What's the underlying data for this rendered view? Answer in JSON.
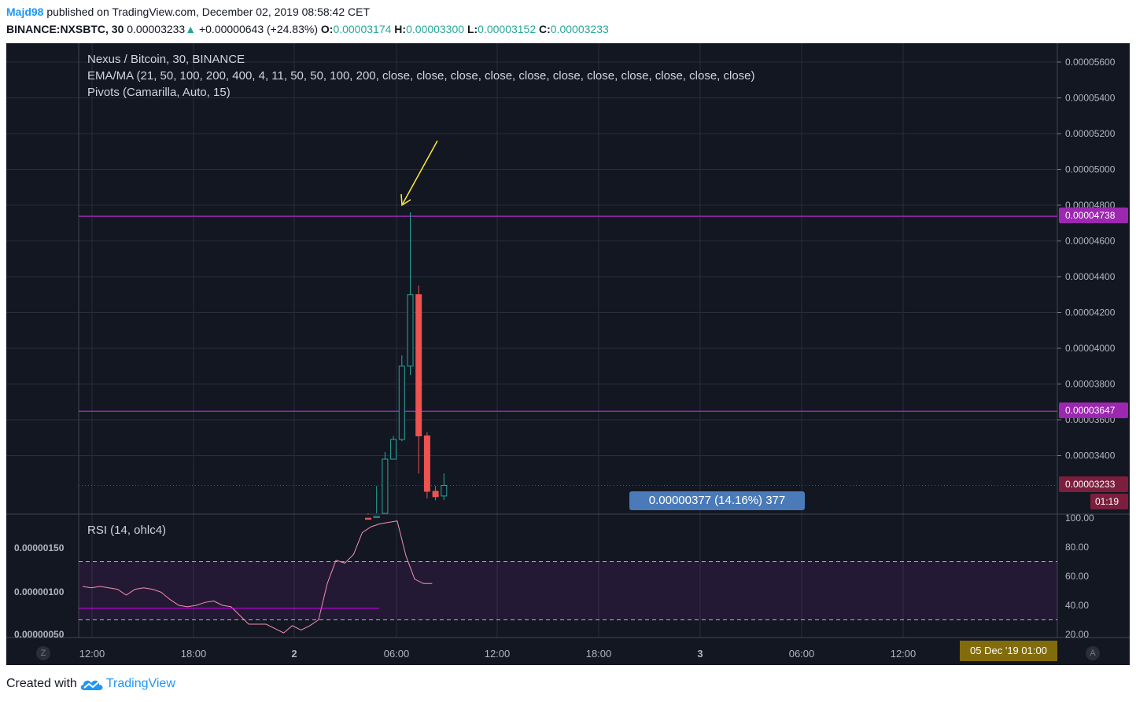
{
  "header": {
    "user": "Majd98",
    "published": " published on TradingView.com, December 02, 2019 08:58:42 CET",
    "symbol": "BINANCE:NXSBTC, 30",
    "last": "0.00003233",
    "arrow": "▲",
    "change": "+0.00000643 (+24.83%)",
    "o_label": "O:",
    "o": "0.00003174",
    "h_label": "H:",
    "h": "0.00003300",
    "l_label": "L:",
    "l": "0.00003152",
    "c_label": "C:",
    "c": "0.00003233"
  },
  "legend": {
    "title": "Nexus / Bitcoin, 30, BINANCE",
    "ma": "EMA/MA (21, 50, 100, 200, 400, 4, 11, 50, 50, 100, 200, close, close, close, close, close, close, close, close, close, close, close)",
    "pivots": "Pivots (Camarilla, Auto, 15)",
    "rsi": "RSI (14, ohlc4)"
  },
  "price_axis": [
    "0.00005600",
    "0.00005400",
    "0.00005200",
    "0.00005000",
    "0.00004800",
    "0.00004600",
    "0.00004400",
    "0.00004200",
    "0.00004000",
    "0.00003800",
    "0.00003600",
    "0.00003400"
  ],
  "price_tags": {
    "pivot_high": "0.00004738",
    "pivot_low": "0.00003647",
    "last": "0.00003233",
    "countdown": "01:19"
  },
  "measure": "0.00000377 (14.16%) 377",
  "rsi_axis": [
    "100.00",
    "80.00",
    "60.00",
    "40.00",
    "20.00"
  ],
  "left_axis": [
    "0.00000150",
    "0.00000100",
    "0.00000050"
  ],
  "time_axis": [
    "12:00",
    "18:00",
    "2",
    "06:00",
    "12:00",
    "18:00",
    "3",
    "06:00",
    "12:00"
  ],
  "date_box": "05 Dec '19   01:00",
  "corner_left": "Z",
  "corner_right": "A",
  "footer": {
    "created": "Created with",
    "brand": "TradingView"
  },
  "colors": {
    "up": "#26a69a",
    "down": "#ef5350",
    "pivot": "#9c27b0",
    "rsi": "#f48fb1",
    "arrow": "#ffeb3b"
  },
  "chart_data": {
    "type": "candlestick",
    "pivot_levels": [
      4.738e-05,
      3.647e-05
    ],
    "last_price": 3.233e-05,
    "candles": [
      {
        "o": 3.05e-05,
        "h": 3.07e-05,
        "l": 3e-05,
        "c": 3.04e-05
      },
      {
        "o": 3.04e-05,
        "h": 3.23e-05,
        "l": 3e-05,
        "c": 3.06e-05
      },
      {
        "o": 3.06e-05,
        "h": 3.42e-05,
        "l": 3.05e-05,
        "c": 3.38e-05
      },
      {
        "o": 3.38e-05,
        "h": 3.51e-05,
        "l": 3.39e-05,
        "c": 3.49e-05
      },
      {
        "o": 3.49e-05,
        "h": 3.96e-05,
        "l": 3.48e-05,
        "c": 3.9e-05
      },
      {
        "o": 3.9e-05,
        "h": 4.76e-05,
        "l": 3.85e-05,
        "c": 4.3e-05
      },
      {
        "o": 4.3e-05,
        "h": 4.35e-05,
        "l": 3.3e-05,
        "c": 3.51e-05
      },
      {
        "o": 3.51e-05,
        "h": 3.53e-05,
        "l": 3.16e-05,
        "c": 3.2e-05
      },
      {
        "o": 3.2e-05,
        "h": 3.23e-05,
        "l": 3.15e-05,
        "c": 3.17e-05
      },
      {
        "o": 3.174e-05,
        "h": 3.3e-05,
        "l": 3.152e-05,
        "c": 3.233e-05
      }
    ],
    "rsi_range": [
      20,
      100
    ],
    "rsi_bands": [
      70,
      30
    ],
    "rsi": [
      53,
      52,
      53,
      52,
      51,
      47,
      51,
      52,
      51,
      49,
      44,
      40,
      39,
      40,
      42,
      43,
      40,
      39,
      33,
      27,
      27,
      27,
      24,
      21,
      26,
      23,
      26,
      30,
      55,
      71,
      69,
      75,
      90,
      94,
      96,
      97,
      98,
      74,
      58,
      55,
      55
    ],
    "rsi_ma_level": 38
  }
}
